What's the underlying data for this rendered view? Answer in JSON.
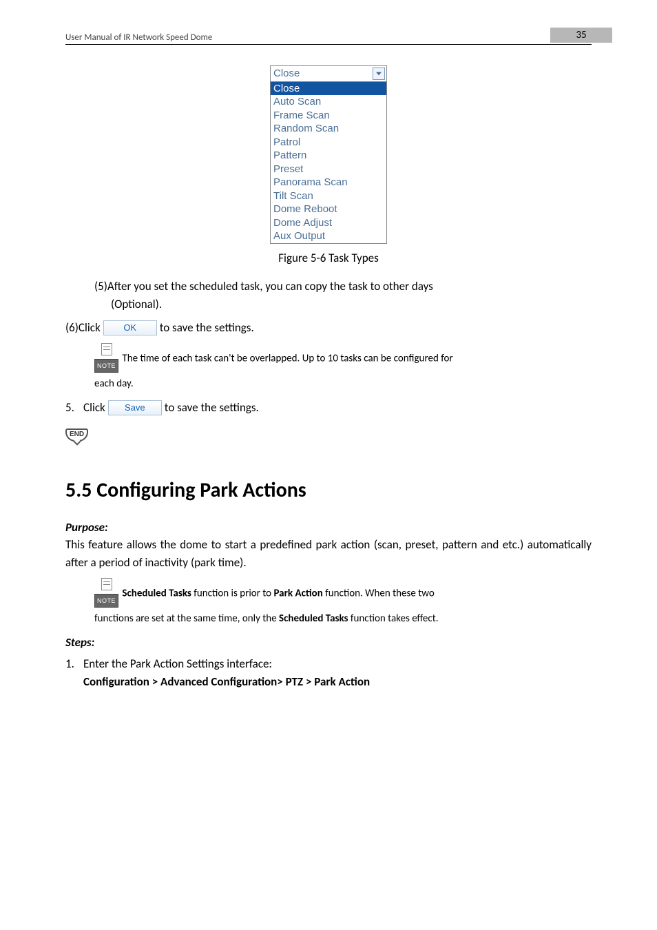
{
  "header": {
    "title": "User Manual of IR Network Speed Dome",
    "page_number": "35"
  },
  "dropdown": {
    "selected_display": "Close",
    "items": [
      "Close",
      "Auto Scan",
      "Frame Scan",
      "Random Scan",
      "Patrol",
      "Pattern",
      "Preset",
      "Panorama Scan",
      "Tilt Scan",
      "Dome Reboot",
      "Dome Adjust",
      "Aux Output"
    ]
  },
  "figure_caption": "Figure 5-6 Task Types",
  "step5_text_a": "(5)After you set the scheduled task, you can copy the task to other days",
  "step5_text_b": "(Optional).",
  "step6_prefix": "(6)Click",
  "step6_suffix": " to save the settings.",
  "ok_button": "OK",
  "note1_a": " The time of each task can't be overlapped. Up to 10 tasks can be configured for",
  "note1_b": "each day.",
  "outer_step5_num": "5.",
  "outer_step5_prefix": "Click ",
  "outer_step5_suffix": " to save the settings.",
  "save_button": "Save",
  "note_icon_label": "NOTE",
  "end_icon_label": "END",
  "section": {
    "heading": "5.5  Configuring Park Actions",
    "purpose_label": "Purpose:",
    "purpose_text": "This feature allows the dome to start a predefined park action (scan, preset, pattern and etc.) automatically after a period of inactivity (park time).",
    "note2_pre": " ",
    "note2_b1": "Scheduled Tasks",
    "note2_mid1": " function is prior to ",
    "note2_b2": "Park Action",
    "note2_mid2": " function. When these two",
    "note2_line2a": "functions are set at the same time, only the ",
    "note2_b3": "Scheduled Tasks",
    "note2_line2b": " function takes effect.",
    "steps_label": "Steps:",
    "step1_num": "1.",
    "step1_text": "Enter the Park Action Settings interface:",
    "step1_path": "Configuration > Advanced Configuration> PTZ > Park Action"
  }
}
